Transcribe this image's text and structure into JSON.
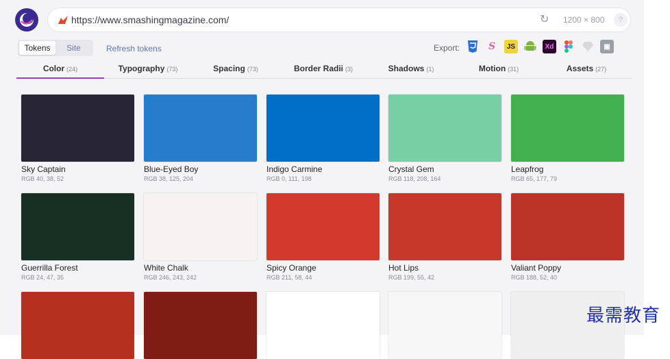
{
  "browser": {
    "url": "https://www.smashingmagazine.com/",
    "viewport_size": "1200 × 800",
    "help": "?"
  },
  "toolbar": {
    "tabs": [
      "Tokens",
      "Site"
    ],
    "active_toggle": "Tokens",
    "refresh": "Refresh tokens",
    "export_label": "Export:",
    "export_icons": [
      "css3-icon",
      "sass-icon",
      "javascript-icon",
      "android-icon",
      "adobe-xd-icon",
      "figma-icon",
      "sketch-icon",
      "mac-app-icon"
    ]
  },
  "tabs": [
    {
      "label": "Color",
      "count": "(24)"
    },
    {
      "label": "Typography",
      "count": "(73)"
    },
    {
      "label": "Spacing",
      "count": "(73)"
    },
    {
      "label": "Border Radii",
      "count": "(3)"
    },
    {
      "label": "Shadows",
      "count": "(1)"
    },
    {
      "label": "Motion",
      "count": "(31)"
    },
    {
      "label": "Assets",
      "count": "(27)"
    }
  ],
  "active_tab": "Color",
  "colors": [
    {
      "name": "Sky Captain",
      "rgb": "RGB 40, 38, 52",
      "hex": "#282634"
    },
    {
      "name": "Blue-Eyed Boy",
      "rgb": "RGB 38, 125, 204",
      "hex": "#267dcc"
    },
    {
      "name": "Indigo Carmine",
      "rgb": "RGB 0, 111, 198",
      "hex": "#006fc6"
    },
    {
      "name": "Crystal Gem",
      "rgb": "RGB 118, 208, 164",
      "hex": "#76d0a4"
    },
    {
      "name": "Leapfrog",
      "rgb": "RGB 65, 177, 79",
      "hex": "#41b14f"
    },
    {
      "name": "Guerrilla Forest",
      "rgb": "RGB 24, 47, 35",
      "hex": "#182f23"
    },
    {
      "name": "White Chalk",
      "rgb": "RGB 246, 243, 242",
      "hex": "#f6f3f2"
    },
    {
      "name": "Spicy Orange",
      "rgb": "RGB 211, 58, 44",
      "hex": "#d33a2c"
    },
    {
      "name": "Hot Lips",
      "rgb": "RGB 199, 55, 42",
      "hex": "#c7372a"
    },
    {
      "name": "Valiant Poppy",
      "rgb": "RGB 188, 52, 40",
      "hex": "#bc3428"
    },
    {
      "name": "",
      "rgb": "",
      "hex": "#b5301f"
    },
    {
      "name": "",
      "rgb": "",
      "hex": "#7f1c14"
    },
    {
      "name": "",
      "rgb": "",
      "hex": "#ffffff"
    },
    {
      "name": "",
      "rgb": "",
      "hex": "#f7f7f7"
    },
    {
      "name": "",
      "rgb": "",
      "hex": "#efefef"
    }
  ],
  "watermark": "最需教育"
}
